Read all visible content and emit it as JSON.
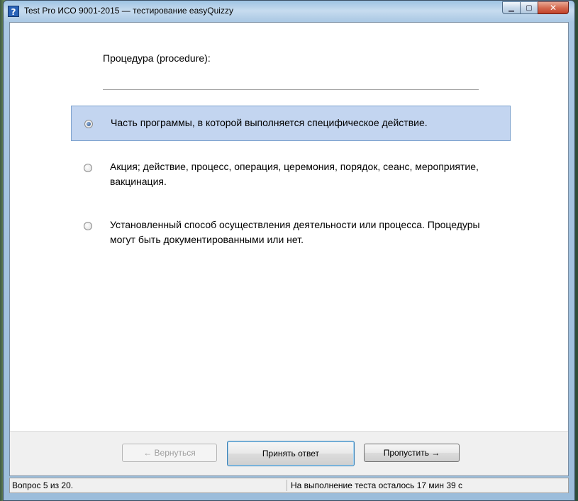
{
  "window": {
    "title": "Test Pro ИСО 9001-2015 — тестирование easyQuizzy",
    "app_icon": "question-mark-icon",
    "caption_buttons": {
      "minimize": "minimize-icon",
      "maximize": "maximize-icon",
      "close": "close-icon"
    }
  },
  "question": {
    "text": "Процедура (procedure):"
  },
  "options": [
    {
      "text": "Часть программы, в которой выполняется специфическое действие.",
      "selected": true
    },
    {
      "text": "Акция; действие, процесс, операция, церемония, порядок, сеанс, мероприятие, вакцинация.",
      "selected": false
    },
    {
      "text": "Установленный способ осуществления деятельности или процесса. Процедуры могут быть документированными или нет.",
      "selected": false
    }
  ],
  "buttons": {
    "back": "← Вернуться",
    "accept": "Принять ответ",
    "skip": "Пропустить →"
  },
  "status": {
    "progress": "Вопрос 5 из 20.",
    "time_left": "На выполнение теста осталось 17 мин 39 с"
  },
  "colors": {
    "selected_background": "#c3d5f0",
    "selected_border": "#7da2ce"
  }
}
